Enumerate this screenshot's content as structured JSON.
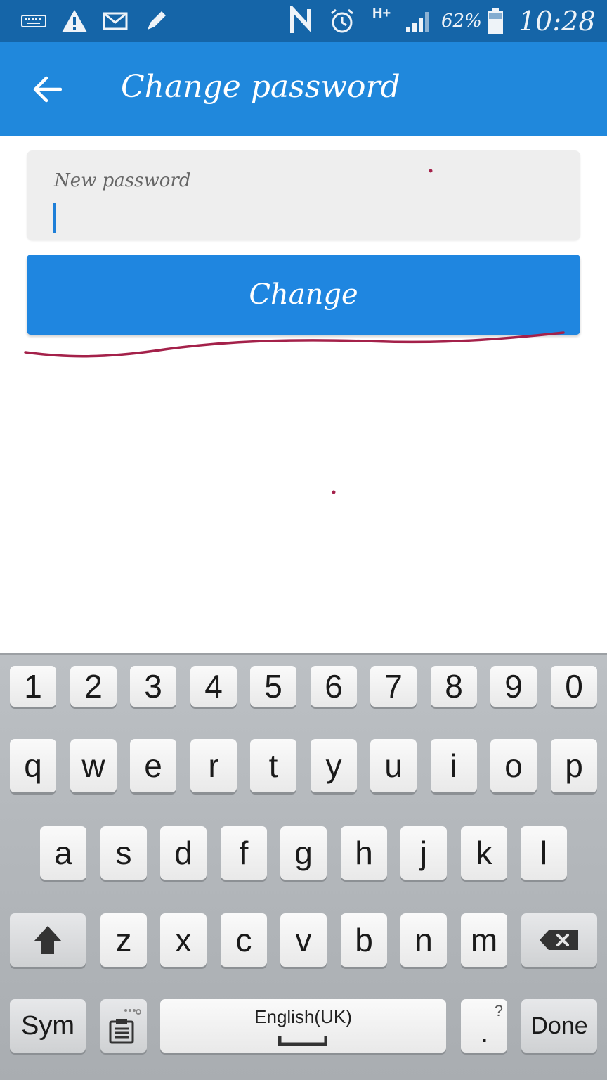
{
  "status_bar": {
    "time": "10:28",
    "battery_percent": "62%",
    "network_type": "H+",
    "icons": [
      "keyboard-icon",
      "warning-icon",
      "mail-icon",
      "pencil-icon",
      "nfc-icon",
      "alarm-icon",
      "network-icon",
      "signal-icon",
      "battery-icon"
    ]
  },
  "app_bar": {
    "title": "Change password",
    "back_icon": "arrow-left-icon"
  },
  "form": {
    "password_label": "New password",
    "password_value": "",
    "change_button": "Change"
  },
  "keyboard": {
    "row_numbers": [
      "1",
      "2",
      "3",
      "4",
      "5",
      "6",
      "7",
      "8",
      "9",
      "0"
    ],
    "row_top": [
      "q",
      "w",
      "e",
      "r",
      "t",
      "y",
      "u",
      "i",
      "o",
      "p"
    ],
    "row_middle": [
      "a",
      "s",
      "d",
      "f",
      "g",
      "h",
      "j",
      "k",
      "l"
    ],
    "row_bottom": [
      "z",
      "x",
      "c",
      "v",
      "b",
      "n",
      "m"
    ],
    "shift_icon": "shift-arrow-icon",
    "backspace_icon": "backspace-icon",
    "sym": "Sym",
    "clipboard_icon": "clipboard-icon",
    "space_label": "English(UK)",
    "punct_key": "?",
    "punct_key_main": ".",
    "done": "Done"
  },
  "colors": {
    "status_bar": "#1565a8",
    "app_bar": "#2088dc",
    "button": "#1f86e0",
    "annotation": "#a4214a"
  }
}
